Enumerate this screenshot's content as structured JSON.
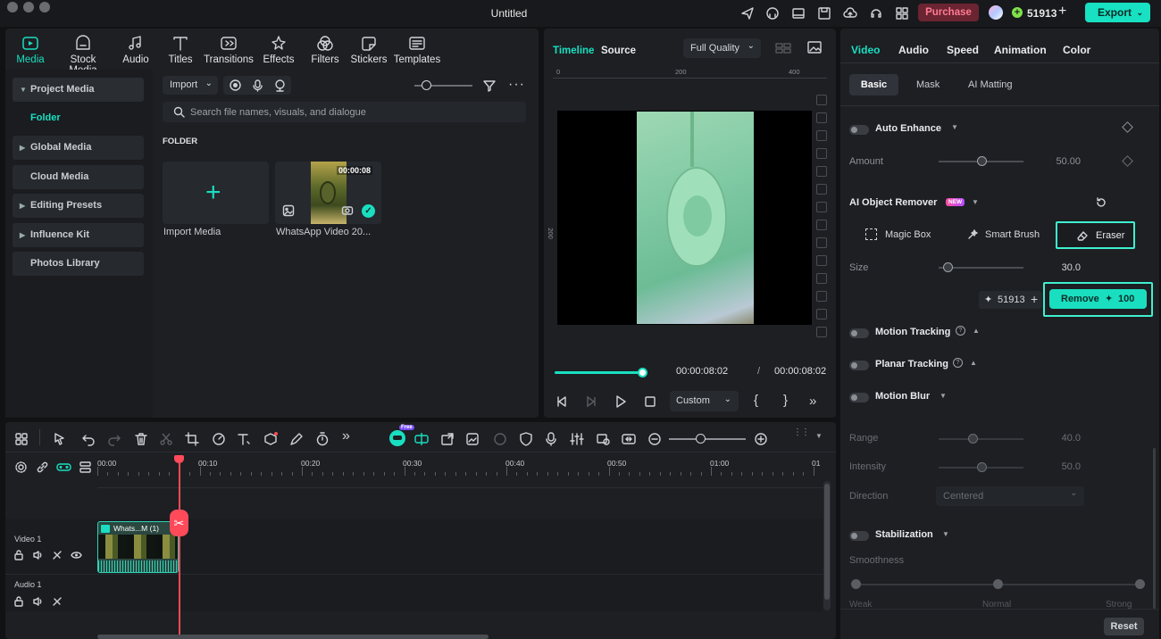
{
  "window": {
    "title": "Untitled",
    "purchase_label": "Purchase",
    "credits": "51913",
    "export_label": "Export"
  },
  "media": {
    "tabs": [
      {
        "label": "Media",
        "icon": "media-icon"
      },
      {
        "label": "Stock Media",
        "icon": "stock-media-icon"
      },
      {
        "label": "Audio",
        "icon": "audio-icon"
      },
      {
        "label": "Titles",
        "icon": "titles-icon"
      },
      {
        "label": "Transitions",
        "icon": "transitions-icon"
      },
      {
        "label": "Effects",
        "icon": "effects-icon"
      },
      {
        "label": "Filters",
        "icon": "filters-icon"
      },
      {
        "label": "Stickers",
        "icon": "stickers-icon"
      },
      {
        "label": "Templates",
        "icon": "templates-icon"
      }
    ],
    "sidebar": {
      "project_media": "Project Media",
      "folder": "Folder",
      "global_media": "Global Media",
      "cloud_media": "Cloud Media",
      "editing_presets": "Editing Presets",
      "influence_kit": "Influence Kit",
      "photos_library": "Photos Library"
    },
    "import_label": "Import",
    "search_placeholder": "Search file names, visuals, and dialogue",
    "folder_heading": "FOLDER",
    "import_media_label": "Import Media",
    "clip_name": "WhatsApp Video 20...",
    "clip_duration": "00:00:08"
  },
  "preview": {
    "tab_timeline": "Timeline",
    "tab_source": "Source",
    "quality": "Full Quality",
    "ruler": [
      "0",
      "200",
      "400"
    ],
    "ruler_side": "200",
    "current_time": "00:00:08:02",
    "separator": "/",
    "total_time": "00:00:08:02",
    "zoom_select": "Custom",
    "progress": 1.0
  },
  "inspector": {
    "tabs": [
      "Video",
      "Audio",
      "Speed",
      "Animation",
      "Color"
    ],
    "subtabs": [
      "Basic",
      "Mask",
      "AI Matting"
    ],
    "auto_enhance": "Auto Enhance",
    "amount_label": "Amount",
    "amount_value": "50.00",
    "amount_level": 0.5,
    "ai_object_remover": "AI Object Remover",
    "new_badge": "NEW",
    "magic_box": "Magic Box",
    "smart_brush": "Smart Brush",
    "eraser": "Eraser",
    "size_label": "Size",
    "size_value": "30.0",
    "size_level": 0.1,
    "credits": "51913",
    "remove_label": "Remove",
    "remove_cost": "100",
    "motion_tracking": "Motion Tracking",
    "planar_tracking": "Planar Tracking",
    "motion_blur": "Motion Blur",
    "range_label": "Range",
    "range_value": "40.0",
    "range_level": 0.4,
    "intensity_label": "Intensity",
    "intensity_value": "50.0",
    "intensity_level": 0.5,
    "direction_label": "Direction",
    "direction_value": "Centered",
    "stabilization": "Stabilization",
    "smoothness_label": "Smoothness",
    "weak": "Weak",
    "normal": "Normal",
    "strong": "Strong",
    "reset_label": "Reset"
  },
  "timeline": {
    "free_badge": "Free",
    "ruler": [
      "00:00",
      "00:10",
      "00:20",
      "00:30",
      "00:40",
      "00:50",
      "01:00",
      "01"
    ],
    "video_track": "Video 1",
    "audio_track": "Audio 1",
    "clip_label": "Whats...M (1)"
  }
}
